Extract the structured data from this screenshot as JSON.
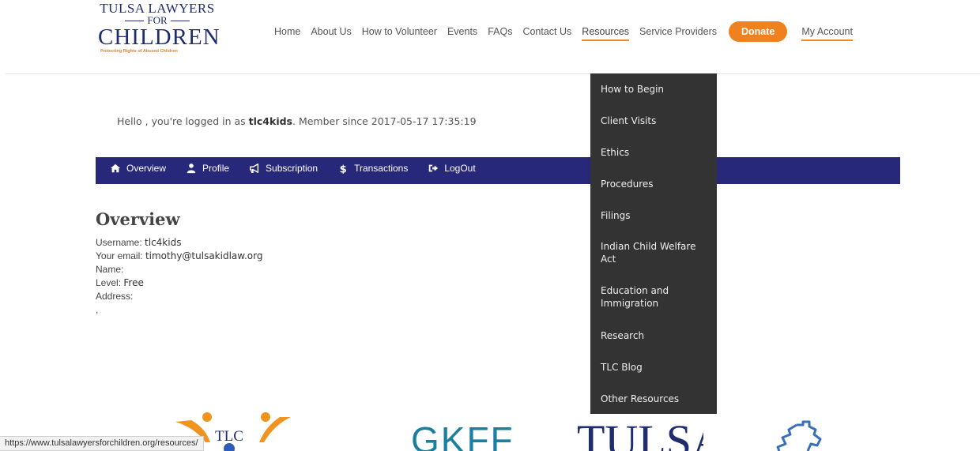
{
  "logo": {
    "line1": "TULSA LAWYERS",
    "line2": "FOR",
    "line3": "CHILDREN",
    "tagline": "Protecting Rights of Abused Children"
  },
  "nav": {
    "items": [
      {
        "label": "Home"
      },
      {
        "label": "About Us"
      },
      {
        "label": "How to Volunteer"
      },
      {
        "label": "Events"
      },
      {
        "label": "FAQs"
      },
      {
        "label": "Contact Us"
      },
      {
        "label": "Resources"
      },
      {
        "label": "Service Providers"
      }
    ],
    "donate_label": "Donate",
    "account_label": "My Account"
  },
  "greeting": {
    "prefix": "Hello , you're logged in as ",
    "username": "tlc4kids",
    "suffix": ". Member since 2017-05-17 17:35:19"
  },
  "account_nav": {
    "tabs": [
      {
        "label": "Overview",
        "icon": "home-icon"
      },
      {
        "label": "Profile",
        "icon": "user-icon"
      },
      {
        "label": "Subscription",
        "icon": "megaphone-icon"
      },
      {
        "label": "Transactions",
        "icon": "dollar-icon"
      },
      {
        "label": "LogOut",
        "icon": "logout-icon"
      }
    ],
    "bg_color": "#28287a"
  },
  "overview": {
    "title": "Overview",
    "username_label": "Username:",
    "username_value": "tlc4kids",
    "email_label": "Your email:",
    "email_value": "timothy@tulsakidlaw.org",
    "name_label": "Name:",
    "level_label": "Level:",
    "level_value": "Free",
    "address_label": "Address:",
    "address_value": ","
  },
  "resources_menu": {
    "items": [
      {
        "label": "How to Begin"
      },
      {
        "label": "Client Visits"
      },
      {
        "label": "Ethics"
      },
      {
        "label": "Procedures"
      },
      {
        "label": "Filings"
      },
      {
        "label": "Indian Child Welfare Act"
      },
      {
        "label": "Education and Immigration"
      },
      {
        "label": "Research"
      },
      {
        "label": "TLC Blog"
      },
      {
        "label": "Other Resources"
      }
    ]
  },
  "footer_logos": {
    "tlc": "TLC",
    "gkff": "GKFF",
    "tulsa": "TULSA"
  },
  "status_bar": {
    "url": "https://www.tulsalawyersforchildren.org/resources/"
  },
  "colors": {
    "accent_orange": "#f0811f",
    "navy": "#1f2d6e",
    "dropdown_bg": "#333333"
  }
}
